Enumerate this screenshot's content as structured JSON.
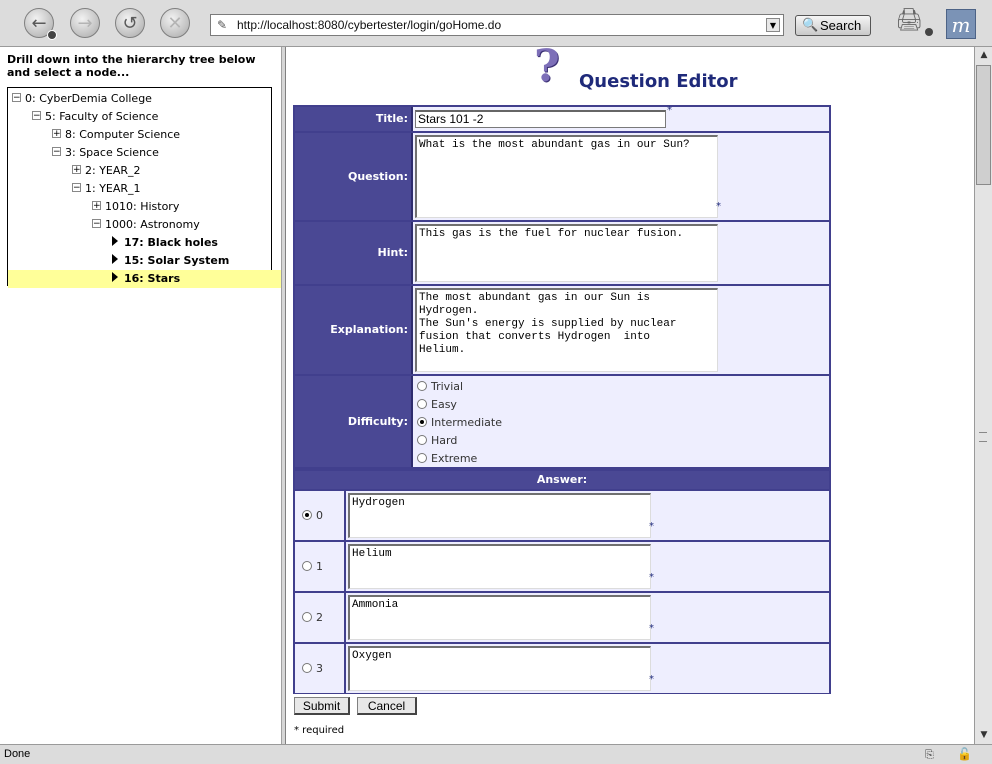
{
  "browser": {
    "url": "http://localhost:8080/cybertester/login/goHome.do",
    "search_label": "Search",
    "status": "Done",
    "icons": [
      "back-icon",
      "forward-icon",
      "reload-icon",
      "stop-icon",
      "page-icon",
      "dropdown-icon",
      "search-icon",
      "print-icon",
      "mozilla-logo-icon",
      "network-icon",
      "lock-icon"
    ]
  },
  "left": {
    "instructions": "Drill down into the hierarchy tree below and select a node...",
    "tree": [
      {
        "label": "0: CyberDemia College",
        "toggle": "⊟",
        "bold": false,
        "selected": false
      },
      {
        "label": "5: Faculty of Science",
        "toggle": "⊟",
        "bold": false,
        "selected": false
      },
      {
        "label": "8: Computer Science",
        "toggle": "⊞",
        "bold": false,
        "selected": false
      },
      {
        "label": "3: Space Science",
        "toggle": "⊟",
        "bold": false,
        "selected": false
      },
      {
        "label": "2: YEAR_2",
        "toggle": "⊞",
        "bold": false,
        "selected": false
      },
      {
        "label": "1: YEAR_1",
        "toggle": "⊟",
        "bold": false,
        "selected": false
      },
      {
        "label": "1010: History",
        "toggle": "⊞",
        "bold": false,
        "selected": false
      },
      {
        "label": "1000: Astronomy",
        "toggle": "⊟",
        "bold": false,
        "selected": false
      },
      {
        "label": "17: Black holes",
        "toggle": "leaf",
        "bold": true,
        "selected": false
      },
      {
        "label": "15: Solar System",
        "toggle": "leaf",
        "bold": true,
        "selected": false
      },
      {
        "label": "16: Stars",
        "toggle": "leaf",
        "bold": true,
        "selected": true
      }
    ]
  },
  "editor": {
    "heading": "Question Editor",
    "labels": {
      "title": "Title:",
      "question": "Question:",
      "hint": "Hint:",
      "explanation": "Explanation:",
      "difficulty": "Difficulty:",
      "answer": "Answer:"
    },
    "required_marker": "*",
    "title_value": "Stars 101 -2",
    "question_value": "What is the most abundant gas in our Sun?",
    "hint_value": "This gas is the fuel for nuclear fusion.",
    "explanation_value": "The most abundant gas in our Sun is\nHydrogen.\nThe Sun's energy is supplied by nuclear\nfusion that converts Hydrogen  into\nHelium.",
    "difficulty_options": [
      "Trivial",
      "Easy",
      "Intermediate",
      "Hard",
      "Extreme"
    ],
    "difficulty_selected": "Intermediate",
    "answers": [
      {
        "index": "0",
        "text": "Hydrogen",
        "checked": true
      },
      {
        "index": "1",
        "text": "Helium",
        "checked": false
      },
      {
        "index": "2",
        "text": "Ammonia",
        "checked": false
      },
      {
        "index": "3",
        "text": "Oxygen",
        "checked": false
      }
    ],
    "submit_label": "Submit",
    "cancel_label": "Cancel",
    "required_note": "* required"
  }
}
